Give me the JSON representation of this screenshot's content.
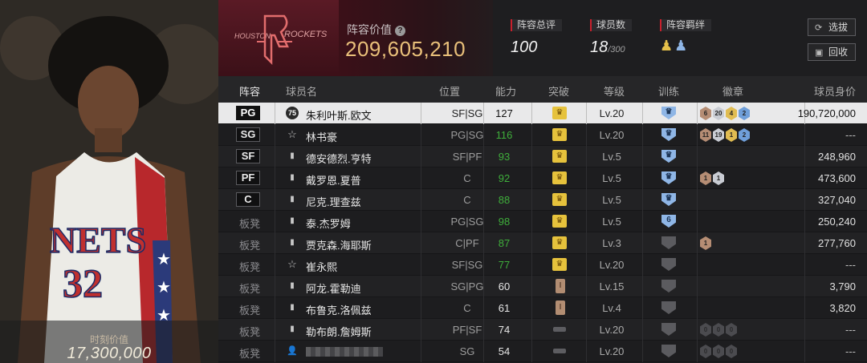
{
  "portrait": {
    "jersey_text": "NETS",
    "jersey_number": "32",
    "moment_label": "时刻价值",
    "moment_value": "17,300,000"
  },
  "team": {
    "logo_text_left": "HOUSTON",
    "logo_text_right": "ROCKETS",
    "value_label": "阵容价值",
    "value": "209,605,210"
  },
  "stats": {
    "overall_label": "阵容总评",
    "overall_value": "100",
    "count_label": "球员数",
    "count_value": "18",
    "count_max": "/300",
    "bond_label": "阵容羁绊"
  },
  "buttons": {
    "select": "选拔",
    "recycle": "回收"
  },
  "columns": {
    "lineup": "阵容",
    "name": "球员名",
    "position": "位置",
    "ability": "能力",
    "breakthrough": "突破",
    "level": "等级",
    "training": "训练",
    "badge": "徽章",
    "worth": "球员身价"
  },
  "accent": {
    "brand": "#5a1a25",
    "gold": "#e9c07a",
    "green": "#3fae3b",
    "blue": "#6f9fd9"
  },
  "players": [
    {
      "slot": "PG",
      "bench": false,
      "icon": "75",
      "name": "朱利叶斯.欧文",
      "pos": "SF|SG",
      "ability": "127",
      "ability_color": "white",
      "break": "crown",
      "level": "Lv.20",
      "train": "blue",
      "badges": [
        {
          "t": "bronze",
          "v": "6"
        },
        {
          "t": "silver",
          "v": "20"
        },
        {
          "t": "gold",
          "v": "4"
        },
        {
          "t": "blue",
          "v": "2"
        }
      ],
      "worth": "190,720,000",
      "selected": true
    },
    {
      "slot": "SG",
      "bench": false,
      "icon": "star",
      "name": "林书豪",
      "pos": "PG|SG",
      "ability": "116",
      "ability_color": "green",
      "break": "crown",
      "level": "Lv.20",
      "train": "blue",
      "badges": [
        {
          "t": "bronze",
          "v": "11"
        },
        {
          "t": "silver",
          "v": "19"
        },
        {
          "t": "gold",
          "v": "1"
        },
        {
          "t": "blue",
          "v": "2"
        }
      ],
      "worth": "---"
    },
    {
      "slot": "SF",
      "bench": false,
      "icon": "bars",
      "name": "德安德烈.亨特",
      "pos": "SF|PF",
      "ability": "93",
      "ability_color": "green",
      "break": "crown",
      "level": "Lv.5",
      "train": "blue",
      "badges": [],
      "worth": "248,960"
    },
    {
      "slot": "PF",
      "bench": false,
      "icon": "bars",
      "name": "戴罗恩.夏普",
      "pos": "C",
      "ability": "92",
      "ability_color": "green",
      "break": "crown",
      "level": "Lv.5",
      "train": "blue",
      "badges": [
        {
          "t": "bronze",
          "v": "1"
        },
        {
          "t": "silver",
          "v": "1"
        }
      ],
      "worth": "473,600"
    },
    {
      "slot": "C",
      "bench": false,
      "icon": "bars",
      "name": "尼克.理查兹",
      "pos": "C",
      "ability": "88",
      "ability_color": "green",
      "break": "crown",
      "level": "Lv.5",
      "train": "blue",
      "badges": [],
      "worth": "327,040"
    },
    {
      "slot": "板凳",
      "bench": true,
      "icon": "bars",
      "name": "泰.杰罗姆",
      "pos": "PG|SG",
      "ability": "98",
      "ability_color": "green",
      "break": "crown",
      "level": "Lv.5",
      "train": "blue6",
      "badges": [],
      "worth": "250,240"
    },
    {
      "slot": "板凳",
      "bench": true,
      "icon": "bars",
      "name": "贾克森.海耶斯",
      "pos": "C|PF",
      "ability": "87",
      "ability_color": "green",
      "break": "crown",
      "level": "Lv.3",
      "train": "dim",
      "badges": [
        {
          "t": "bronze",
          "v": "1"
        }
      ],
      "worth": "277,760"
    },
    {
      "slot": "板凳",
      "bench": true,
      "icon": "star",
      "name": "崔永熙",
      "pos": "SF|SG",
      "ability": "77",
      "ability_color": "green",
      "break": "crown",
      "level": "Lv.20",
      "train": "dim",
      "badges": [],
      "worth": "---"
    },
    {
      "slot": "板凳",
      "bench": true,
      "icon": "bars",
      "name": "阿龙.霍勒迪",
      "pos": "SG|PG",
      "ability": "60",
      "ability_color": "white",
      "break": "brown",
      "level": "Lv.15",
      "train": "dim",
      "badges": [],
      "worth": "3,790"
    },
    {
      "slot": "板凳",
      "bench": true,
      "icon": "bars",
      "name": "布鲁克.洛佩兹",
      "pos": "C",
      "ability": "61",
      "ability_color": "white",
      "break": "brown",
      "level": "Lv.4",
      "train": "dim",
      "badges": [],
      "worth": "3,820"
    },
    {
      "slot": "板凳",
      "bench": true,
      "icon": "bars",
      "name": "勒布朗.詹姆斯",
      "pos": "PF|SF",
      "ability": "74",
      "ability_color": "white",
      "break": "dash",
      "level": "Lv.20",
      "train": "dim",
      "badges": [
        {
          "t": "dim",
          "v": "0"
        },
        {
          "t": "dim",
          "v": "0"
        },
        {
          "t": "dim",
          "v": "0"
        }
      ],
      "worth": "---"
    },
    {
      "slot": "板凳",
      "bench": true,
      "icon": "user",
      "name": "",
      "pos": "SG",
      "ability": "54",
      "ability_color": "white",
      "break": "dash",
      "level": "Lv.20",
      "train": "dim",
      "badges": [
        {
          "t": "dim",
          "v": "0"
        },
        {
          "t": "dim",
          "v": "0"
        },
        {
          "t": "dim",
          "v": "0"
        }
      ],
      "worth": "---"
    }
  ]
}
